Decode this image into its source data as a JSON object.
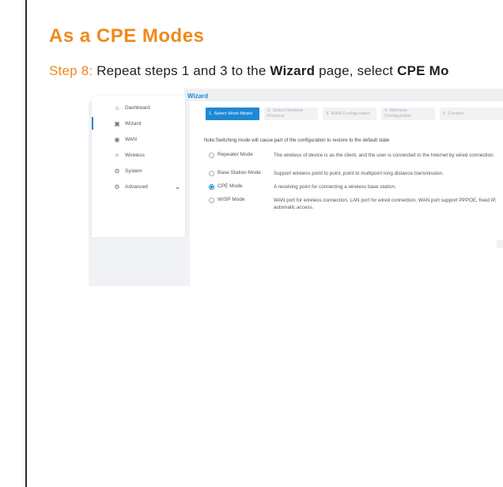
{
  "doc": {
    "heading": "As a CPE Modes",
    "step_label": "Step 8:",
    "step_text_1": " Repeat steps 1 and 3 to the ",
    "step_bold_1": "Wizard",
    "step_text_2": " page, select ",
    "step_bold_2": "CPE Mo"
  },
  "app": {
    "page_title": "Wizard",
    "sidebar": {
      "items": [
        {
          "label": "Dashboard",
          "icon": "home-icon"
        },
        {
          "label": "Wizard",
          "icon": "wizard-icon",
          "active": true
        },
        {
          "label": "WAN",
          "icon": "globe-icon"
        },
        {
          "label": "Wireless",
          "icon": "wifi-icon"
        },
        {
          "label": "System",
          "icon": "gear-icon"
        },
        {
          "label": "Advanced",
          "icon": "gears-icon",
          "expandable": true
        }
      ]
    },
    "steps": [
      {
        "label": "1. Select Work Model",
        "active": true
      },
      {
        "label": "2. Select Network Protocol"
      },
      {
        "label": "3. WAN Configuration"
      },
      {
        "label": "4. Wireless Configuration"
      },
      {
        "label": "5. Confirm"
      }
    ],
    "note": "Note:Switching mode will cause part of the configuration to restore to the default state",
    "modes": [
      {
        "name": "Repeater Mode",
        "desc": "The wireless of device is as the client, and the user is connected to the Internet by wired connection.",
        "selected": false
      },
      {
        "name": "Base Station Mode",
        "desc": "Support wireless point to point, point to multipoint long distance transmission.",
        "selected": false
      },
      {
        "name": "CPE Mode",
        "desc": "A receiving point for connecting a wireless base station.",
        "selected": true
      },
      {
        "name": "WISP Mode",
        "desc": "WAN port for wireless connection, LAN port for wired connection, WAN port support PPPOE, fixed IP, automatic access.",
        "selected": false
      }
    ],
    "colors": {
      "accent": "#1e88d6",
      "heading": "#ef8a1c"
    }
  }
}
